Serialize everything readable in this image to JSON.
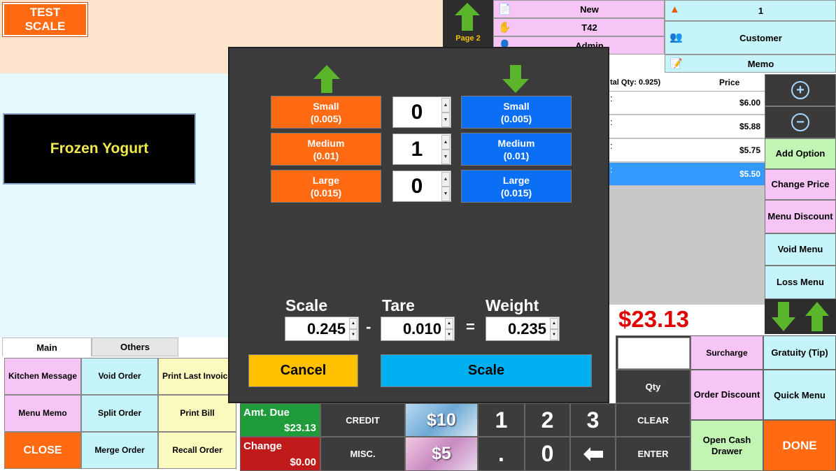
{
  "top": {
    "test_scale": "TEST\nSCALE",
    "menu_title": "Frozen Yogurt",
    "page_label": "Page 2"
  },
  "info": {
    "order_type": "New",
    "table": "T42",
    "user": "Admin",
    "guests": "1",
    "customer": "Customer",
    "memo": "Memo"
  },
  "order": {
    "header_left": "tal Qty: 0.925)",
    "header_price": "Price",
    "rows": [
      {
        "mark": ":",
        "price": "$6.00"
      },
      {
        "mark": ":",
        "price": "$5.88"
      },
      {
        "mark": ":",
        "price": "$5.75"
      },
      {
        "mark": ":",
        "price": "$5.50"
      }
    ],
    "total": "$23.13"
  },
  "right": {
    "add_option": "Add Option",
    "change_price": "Change Price",
    "menu_discount": "Menu Discount",
    "void_menu": "Void Menu",
    "loss_menu": "Loss Menu"
  },
  "tabs": {
    "main": "Main",
    "others": "Others"
  },
  "grid": {
    "kitchen_message": "Kitchen Message",
    "void_order": "Void Order",
    "print_last_invoice": "Print Last Invoice",
    "menu_memo": "Menu Memo",
    "split_order": "Split Order",
    "print_bill": "Print Bill",
    "close": "CLOSE",
    "merge_order": "Merge Order",
    "recall_order": "Recall Order"
  },
  "payment": {
    "amt_due_label": "Amt. Due",
    "amt_due_value": "$23.13",
    "change_label": "Change",
    "change_value": "$0.00",
    "credit": "CREDIT",
    "misc": "MISC.",
    "ten": "$10",
    "five": "$5"
  },
  "keypad": {
    "one": "1",
    "two": "2",
    "three": "3",
    "dot": ".",
    "zero": "0",
    "qty": "Qty",
    "clear": "CLEAR",
    "enter": "ENTER"
  },
  "side": {
    "surcharge": "Surcharge",
    "gratuity": "Gratuity (Tip)",
    "order_discount": "Order Discount",
    "quick_menu": "Quick Menu",
    "open_cash_drawer": "Open Cash Drawer",
    "done": "DONE"
  },
  "modal": {
    "sizes": [
      {
        "name": "Small",
        "amount": "(0.005)",
        "qty": "0"
      },
      {
        "name": "Medium",
        "amount": "(0.01)",
        "qty": "1"
      },
      {
        "name": "Large",
        "amount": "(0.015)",
        "qty": "0"
      }
    ],
    "scale_label": "Scale",
    "tare_label": "Tare",
    "weight_label": "Weight",
    "scale_value": "0.245",
    "tare_value": "0.010",
    "weight_value": "0.235",
    "minus": "-",
    "equals": "=",
    "cancel": "Cancel",
    "scale_button": "Scale"
  },
  "colors": {
    "orange": "#ff6a13",
    "blue": "#0a6ff5",
    "cancel": "#ffc000",
    "scale_button": "#00b0f0",
    "total_red": "#e00000",
    "arrow_green": "#5ab52a"
  }
}
